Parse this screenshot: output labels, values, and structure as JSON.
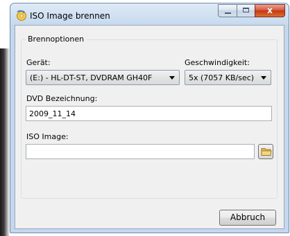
{
  "window": {
    "title": "ISO Image brennen"
  },
  "group": {
    "legend": "Brennoptionen"
  },
  "device": {
    "label": "Gerät:",
    "value": "(E:) - HL-DT-ST, DVDRAM GH40F"
  },
  "speed": {
    "label": "Geschwindigkeit:",
    "value": "5x (7057 KB/sec)"
  },
  "dvd_label": {
    "label": "DVD Bezeichnung:",
    "value": "2009_11_14"
  },
  "iso_image": {
    "label": "ISO Image:",
    "value": ""
  },
  "buttons": {
    "cancel": "Abbruch",
    "close_glyph": "x"
  }
}
